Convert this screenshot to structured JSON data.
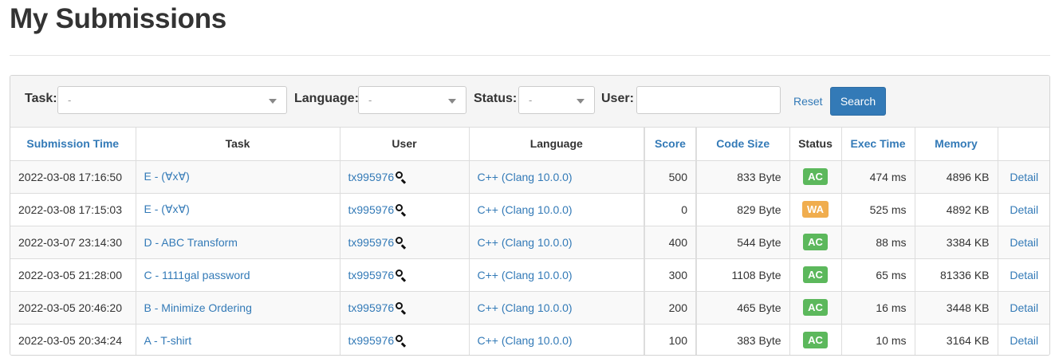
{
  "page": {
    "title": "My Submissions"
  },
  "filters": {
    "task_label": "Task:",
    "task_value": "-",
    "language_label": "Language:",
    "language_value": "-",
    "status_label": "Status:",
    "status_value": "-",
    "user_label": "User:",
    "user_value": "",
    "reset_label": "Reset",
    "search_label": "Search"
  },
  "table": {
    "headers": [
      "Submission Time",
      "Task",
      "User",
      "Language",
      "Score",
      "Code Size",
      "Status",
      "Exec Time",
      "Memory",
      ""
    ],
    "rows": [
      {
        "time": "2022-03-08 17:16:50",
        "task": "E - (∀x∀)",
        "user": "tx995976",
        "language": "C++ (Clang 10.0.0)",
        "score": "500",
        "code_size": "833 Byte",
        "status": "AC",
        "exec_time": "474 ms",
        "memory": "4896 KB",
        "detail": "Detail"
      },
      {
        "time": "2022-03-08 17:15:03",
        "task": "E - (∀x∀)",
        "user": "tx995976",
        "language": "C++ (Clang 10.0.0)",
        "score": "0",
        "code_size": "829 Byte",
        "status": "WA",
        "exec_time": "525 ms",
        "memory": "4892 KB",
        "detail": "Detail"
      },
      {
        "time": "2022-03-07 23:14:30",
        "task": "D - ABC Transform",
        "user": "tx995976",
        "language": "C++ (Clang 10.0.0)",
        "score": "400",
        "code_size": "544 Byte",
        "status": "AC",
        "exec_time": "88 ms",
        "memory": "3384 KB",
        "detail": "Detail"
      },
      {
        "time": "2022-03-05 21:28:00",
        "task": "C - 1111gal password",
        "user": "tx995976",
        "language": "C++ (Clang 10.0.0)",
        "score": "300",
        "code_size": "1108 Byte",
        "status": "AC",
        "exec_time": "65 ms",
        "memory": "81336 KB",
        "detail": "Detail"
      },
      {
        "time": "2022-03-05 20:46:20",
        "task": "B - Minimize Ordering",
        "user": "tx995976",
        "language": "C++ (Clang 10.0.0)",
        "score": "200",
        "code_size": "465 Byte",
        "status": "AC",
        "exec_time": "16 ms",
        "memory": "3448 KB",
        "detail": "Detail"
      },
      {
        "time": "2022-03-05 20:34:24",
        "task": "A - T-shirt",
        "user": "tx995976",
        "language": "C++ (Clang 10.0.0)",
        "score": "100",
        "code_size": "383 Byte",
        "status": "AC",
        "exec_time": "10 ms",
        "memory": "3164 KB",
        "detail": "Detail"
      }
    ]
  },
  "colors": {
    "link": "#337ab7",
    "ac": "#5cb85c",
    "wa": "#f0ad4e",
    "button": "#337ab7"
  },
  "icons": {
    "user_search": "magnifier-icon",
    "select_caret": "chevron-down-icon"
  }
}
